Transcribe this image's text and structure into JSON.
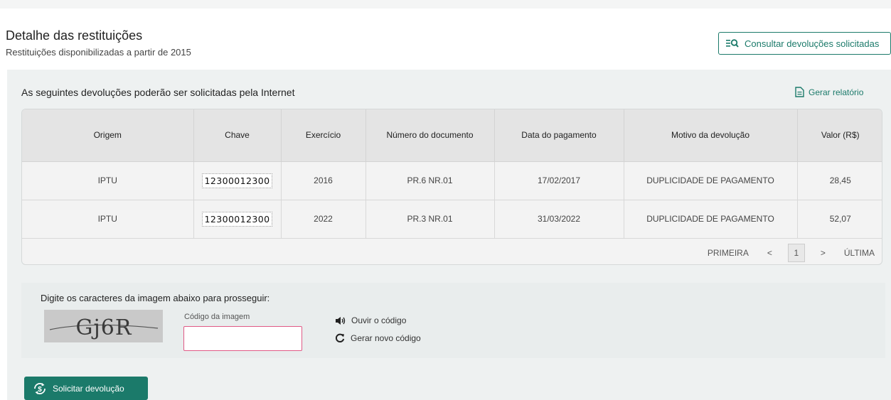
{
  "header": {
    "title": "Detalhe das restituições",
    "subtitle": "Restituições disponibilizadas a partir de 2015",
    "consult_button": "Consultar devoluções solicitadas"
  },
  "panel": {
    "heading": "As seguintes devoluções poderão ser solicitadas pela Internet",
    "report_link": "Gerar relatório"
  },
  "table": {
    "columns": [
      "Origem",
      "Chave",
      "Exercício",
      "Número do documento",
      "Data do pagamento",
      "Motivo da devolução",
      "Valor (R$)"
    ],
    "rows": [
      [
        "IPTU",
        "12300012300",
        "2016",
        "PR.6 NR.01",
        "17/02/2017",
        "DUPLICIDADE DE PAGAMENTO",
        "28,45"
      ],
      [
        "IPTU",
        "12300012300",
        "2022",
        "PR.3 NR.01",
        "31/03/2022",
        "DUPLICIDADE DE PAGAMENTO",
        "52,07"
      ]
    ]
  },
  "pagination": {
    "first": "PRIMEIRA",
    "prev": "<",
    "current": "1",
    "next": ">",
    "last": "ÚLTIMA"
  },
  "captcha": {
    "prompt": "Digite os caracteres da imagem abaixo para prosseguir:",
    "image_text": "Gj6R",
    "field_label": "Código da imagem",
    "value": "",
    "listen": "Ouvir o código",
    "regenerate": "Gerar novo código"
  },
  "submit_button": "Solicitar devolução",
  "colors": {
    "accent": "#1b7a6a",
    "input_border": "#e05a86",
    "panel_bg": "#eef1f1"
  }
}
